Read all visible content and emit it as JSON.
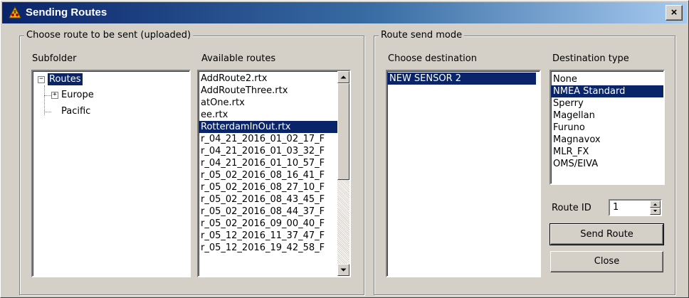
{
  "window": {
    "title": "Sending Routes",
    "close_glyph": "×"
  },
  "choose_route": {
    "legend": "Choose route to be sent (uploaded)",
    "subfolder_label": "Subfolder",
    "available_label": "Available routes",
    "tree": {
      "root": "Routes",
      "children": [
        "Europe",
        "Pacific"
      ]
    },
    "routes": [
      "AddRoute2.rtx",
      "AddRouteThree.rtx",
      "atOne.rtx",
      "ee.rtx",
      "RotterdamInOut.rtx",
      "r_04_21_2016_01_02_17_F",
      "r_04_21_2016_01_03_32_F",
      "r_04_21_2016_01_10_57_F",
      "r_05_02_2016_08_16_41_F",
      "r_05_02_2016_08_27_10_F",
      "r_05_02_2016_08_43_45_F",
      "r_05_02_2016_08_44_37_F",
      "r_05_02_2016_09_00_40_F",
      "r_05_12_2016_11_37_47_F",
      "r_05_12_2016_19_42_58_F"
    ],
    "selected_route": "RotterdamInOut.rtx"
  },
  "send_mode": {
    "legend": "Route send mode",
    "destination_label": "Choose destination",
    "destinations": [
      "NEW SENSOR 2"
    ],
    "type_label": "Destination type",
    "types": [
      "None",
      "NMEA Standard",
      "Sperry",
      "Magellan",
      "Furuno",
      "Magnavox",
      "MLR_FX",
      "OMS/EIVA"
    ],
    "selected_type": "NMEA Standard",
    "route_id_label": "Route ID",
    "route_id_value": "1",
    "send_label": "Send Route",
    "close_label": "Close"
  },
  "colors": {
    "selection": "#0a246a",
    "face": "#d4d0c8"
  }
}
